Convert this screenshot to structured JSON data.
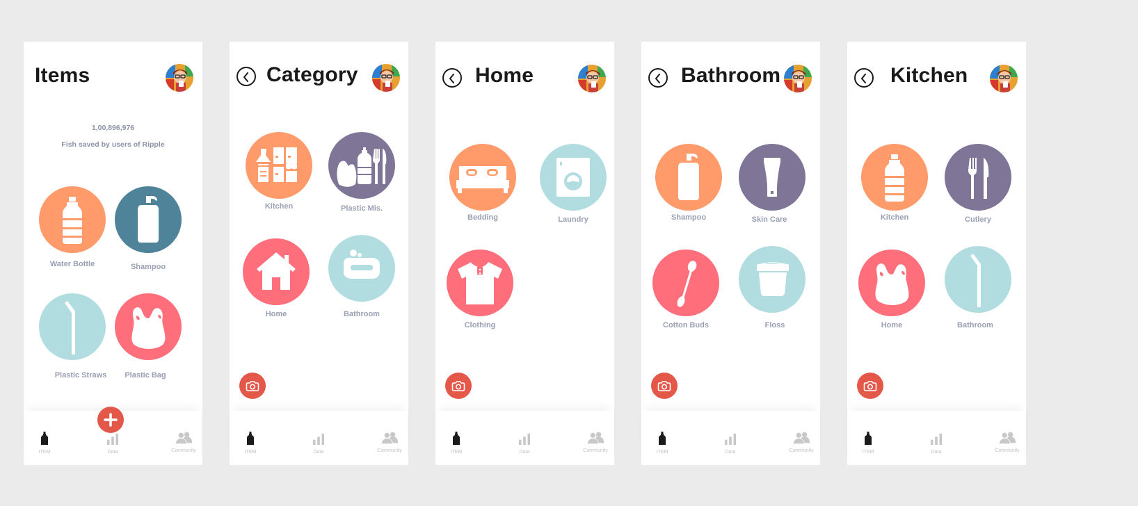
{
  "colors": {
    "orange": "#ff9a6b",
    "purple": "#7f7697",
    "teal": "#4e8399",
    "coral": "#ff6f7b",
    "lightblue": "#b1dde1",
    "accent": "#e4584a"
  },
  "nav": {
    "item": "ITEM",
    "data": "Data",
    "community": "Community"
  },
  "items_screen": {
    "title": "Items",
    "count": "1,00,896,976",
    "subtitle": "Fish saved by users of Ripple",
    "tiles": [
      {
        "label": "Water Bottle",
        "icon": "bottle-icon"
      },
      {
        "label": "Shampoo",
        "icon": "shampoo-bottle-icon"
      },
      {
        "label": "Plastic Straws",
        "icon": "straw-icon"
      },
      {
        "label": "Plastic Bag",
        "icon": "plastic-bag-icon"
      }
    ]
  },
  "category_screen": {
    "title": "Category",
    "tiles": [
      {
        "label": "Kitchen",
        "icon": "kitchen-cabinet-icon"
      },
      {
        "label": "Plastic Mis.",
        "icon": "plastic-misc-icon"
      },
      {
        "label": "Home",
        "icon": "house-icon"
      },
      {
        "label": "Bathroom",
        "icon": "soap-icon"
      }
    ]
  },
  "home_screen": {
    "title": "Home",
    "tiles": [
      {
        "label": "Bedding",
        "icon": "bed-icon"
      },
      {
        "label": "Laundry",
        "icon": "washing-machine-icon"
      },
      {
        "label": "Clothing",
        "icon": "shirt-icon"
      }
    ]
  },
  "bathroom_screen": {
    "title": "Bathroom",
    "tiles": [
      {
        "label": "Shampoo",
        "icon": "shampoo-bottle-icon"
      },
      {
        "label": "Skin Care",
        "icon": "tube-icon"
      },
      {
        "label": "Cotton Buds",
        "icon": "cotton-bud-icon"
      },
      {
        "label": "Floss",
        "icon": "floss-container-icon"
      }
    ]
  },
  "kitchen_screen": {
    "title": "Kitchen",
    "tiles": [
      {
        "label": "Kitchen",
        "icon": "bottle-icon"
      },
      {
        "label": "Cutlery",
        "icon": "cutlery-icon"
      },
      {
        "label": "Home",
        "icon": "plastic-bag-icon"
      },
      {
        "label": "Bathroom",
        "icon": "straw-icon"
      }
    ]
  }
}
